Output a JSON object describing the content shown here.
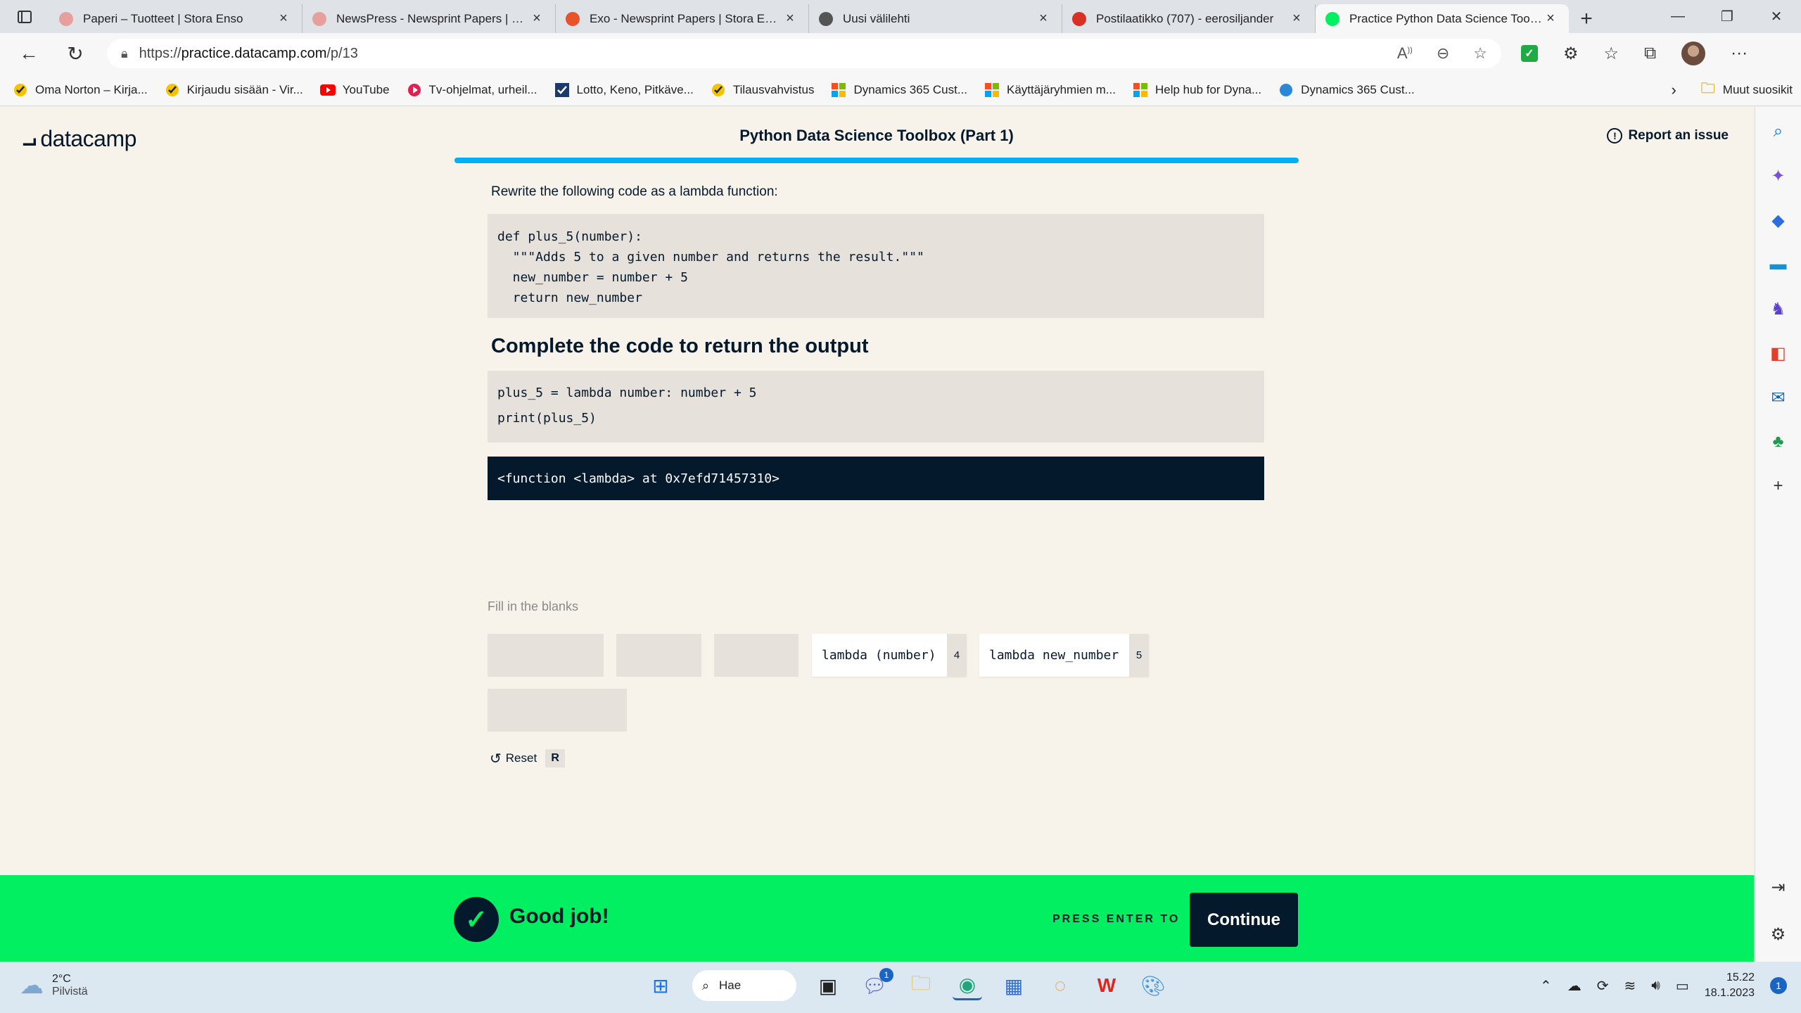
{
  "browser": {
    "tabs": [
      {
        "title": "Paperi – Tuotteet | Stora Enso",
        "favicon_color": "#e6a09b",
        "active": false
      },
      {
        "title": "NewsPress - Newsprint Papers | Stora Enso",
        "favicon_color": "#e6a09b",
        "active": false
      },
      {
        "title": "Exo - Newsprint Papers | Stora Enso",
        "favicon_color": "#e8532b",
        "active": false
      },
      {
        "title": "Uusi välilehti",
        "favicon_color": "#555555",
        "active": false
      },
      {
        "title": "Postilaatikko (707) - eerosiljander",
        "favicon_color": "#d93025",
        "active": false
      },
      {
        "title": "Practice Python Data Science Toolbox",
        "favicon_color": "#03ef62",
        "active": true
      }
    ],
    "url": {
      "scheme": "https://",
      "host": "practice.datacamp.com",
      "path": "/p/13"
    },
    "bookmarks": [
      {
        "label": "Oma Norton – Kirja...",
        "icon": "norton-check-icon",
        "color": "#f5c400"
      },
      {
        "label": "Kirjaudu sisään - Vir...",
        "icon": "norton-check-icon",
        "color": "#f5c400"
      },
      {
        "label": "YouTube",
        "icon": "youtube-icon",
        "color": "#ff0000"
      },
      {
        "label": "Tv-ohjelmat, urheil...",
        "icon": "play-icon",
        "color": "#e21f4e"
      },
      {
        "label": "Lotto, Keno, Pitkäve...",
        "icon": "veikkaus-icon",
        "color": "#1b3a6b"
      },
      {
        "label": "Tilausvahvistus",
        "icon": "norton-check-icon",
        "color": "#f5c400"
      },
      {
        "label": "Dynamics 365 Cust...",
        "icon": "microsoft-icon",
        "color": "#f25022"
      },
      {
        "label": "Käyttäjäryhmien m...",
        "icon": "microsoft-icon",
        "color": "#f25022"
      },
      {
        "label": "Help hub for Dyna...",
        "icon": "microsoft-icon",
        "color": "#f25022"
      },
      {
        "label": "Dynamics 365 Cust...",
        "icon": "dynamics-icon",
        "color": "#2b88d8"
      }
    ],
    "other_favorites": "Muut suosikit"
  },
  "app": {
    "logo_text": "datacamp",
    "course_title": "Python Data Science Toolbox (Part 1)",
    "report_label": "Report an issue",
    "accent": "#03aff0"
  },
  "exercise": {
    "instruction": "Rewrite the following code as a lambda function:",
    "original_code": "def plus_5(number):\n  \"\"\"Adds 5 to a given number and returns the result.\"\"\"\n  new_number = number + 5\n  return new_number",
    "heading": "Complete the code to return the output",
    "answer_code": "plus_5 = lambda number: number + 5\nprint(plus_5)",
    "output": "<function <lambda> at 0x7efd71457310>",
    "fill_label": "Fill in the blanks",
    "options": [
      {
        "text": "lambda (number)",
        "key": "4"
      },
      {
        "text": "lambda new_number",
        "key": "5"
      }
    ],
    "reset_label": "Reset",
    "reset_key": "R"
  },
  "feedback": {
    "message": "Good job!",
    "press_hint": "PRESS ENTER TO",
    "continue_label": "Continue",
    "color": "#03ef62"
  },
  "taskbar": {
    "temperature": "2°C",
    "condition": "Pilvistä",
    "search_label": "Hae",
    "chat_badge": "1",
    "time": "15.22",
    "date": "18.1.2023",
    "notification_count": "1"
  }
}
